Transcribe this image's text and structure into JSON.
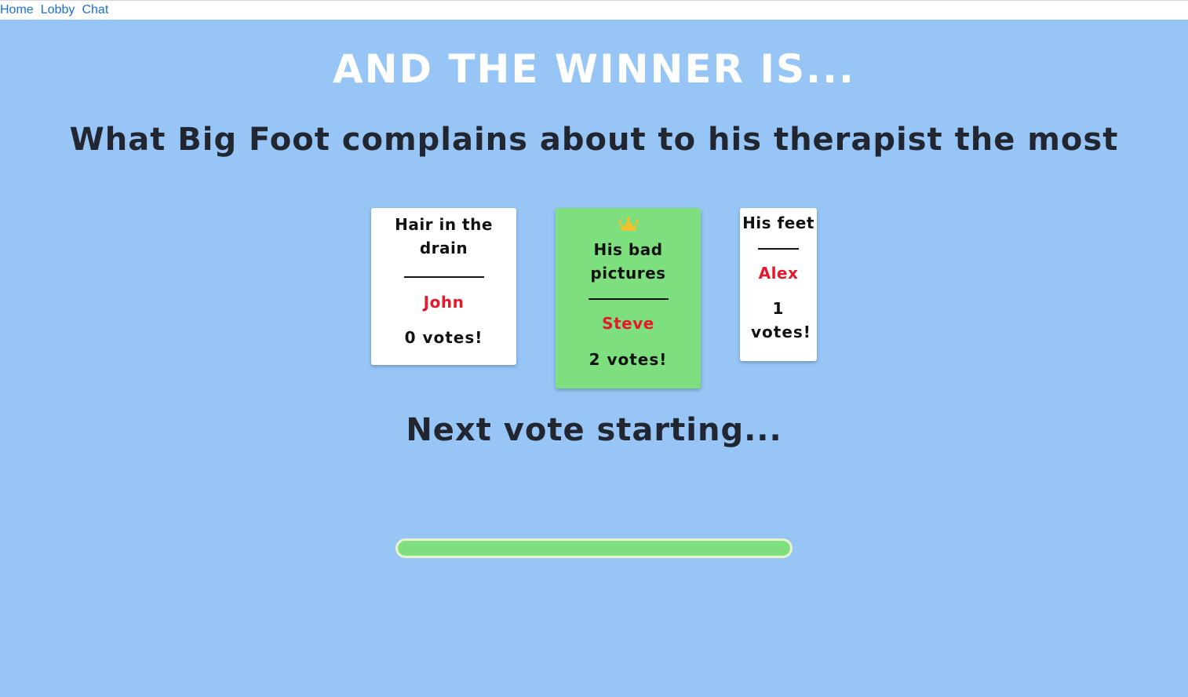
{
  "nav": {
    "links": [
      "Home",
      "Lobby",
      "Chat"
    ]
  },
  "header": {
    "title": "AND THE WINNER IS..."
  },
  "prompt": {
    "text": "What Big Foot complains about to his therapist the most"
  },
  "cards": [
    {
      "answer": "Hair in the drain",
      "author": "John",
      "votes": "0 votes!",
      "winner": false
    },
    {
      "answer": "His bad pictures",
      "author": "Steve",
      "votes": "2 votes!",
      "winner": true,
      "icon": "crown-icon"
    },
    {
      "answer": "His feet",
      "author": "Alex",
      "votes": "1 votes!",
      "winner": false
    }
  ],
  "status": {
    "next_text": "Next vote starting..."
  },
  "progress": {
    "fraction": 1.0
  },
  "colors": {
    "background": "#96c5f6",
    "winner_card": "#7ddf7e",
    "author": "#e8182c",
    "crown": "#f2c12e",
    "progress_fill": "#7ddf7e",
    "link": "#1a6fd8"
  }
}
